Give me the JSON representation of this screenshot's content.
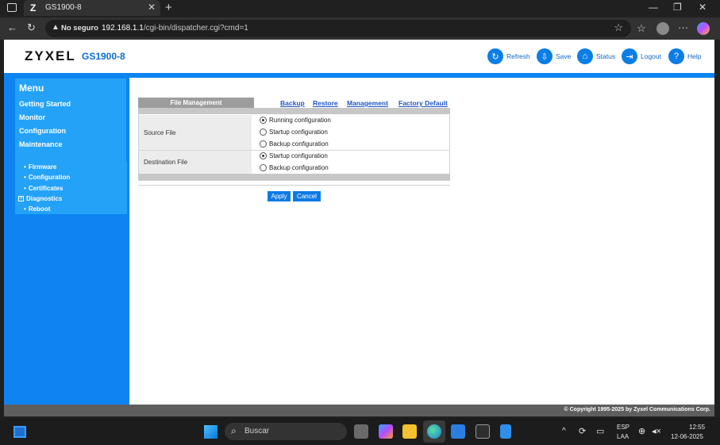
{
  "browser": {
    "tab_title": "GS1900-8",
    "tab_favicon": "Z",
    "security_label": "No seguro",
    "url_host": "192.168.1.1",
    "url_path": "/cgi-bin/dispatcher.cgi?cmd=1"
  },
  "header": {
    "brand": "ZYXEL",
    "model": "GS1900-8",
    "buttons": [
      {
        "label": "Refresh",
        "icon": "refresh-icon"
      },
      {
        "label": "Save",
        "icon": "save-icon"
      },
      {
        "label": "Status",
        "icon": "status-icon"
      },
      {
        "label": "Logout",
        "icon": "logout-icon"
      },
      {
        "label": "Help",
        "icon": "help-icon"
      }
    ]
  },
  "menu": {
    "title": "Menu",
    "items": [
      "Getting Started",
      "Monitor",
      "Configuration",
      "Maintenance"
    ],
    "subitems": [
      "Firmware",
      "Configuration",
      "Certificates",
      "Diagnostics",
      "Reboot"
    ]
  },
  "content": {
    "section_tab": "File Management",
    "links": [
      "Backup",
      "Restore",
      "Management",
      "Factory Default"
    ],
    "source_label": "Source File",
    "source_options": [
      "Running configuration",
      "Startup configuration",
      "Backup configuration"
    ],
    "source_selected": "Running configuration",
    "dest_label": "Destination File",
    "dest_options": [
      "Startup configuration",
      "Backup configuration"
    ],
    "dest_selected": "Startup configuration",
    "apply_label": "Apply",
    "cancel_label": "Cancel"
  },
  "footer": {
    "copyright": "© Copyright 1995-2025 by Zyxel Communications Corp."
  },
  "taskbar": {
    "search_placeholder": "Buscar",
    "lang1": "ESP",
    "lang2": "LAA",
    "time": "12:55",
    "date": "12-06-2025"
  },
  "colors": {
    "accent": "#0c84f0",
    "menu_light": "#24a2f8",
    "link": "#1f56c4"
  }
}
